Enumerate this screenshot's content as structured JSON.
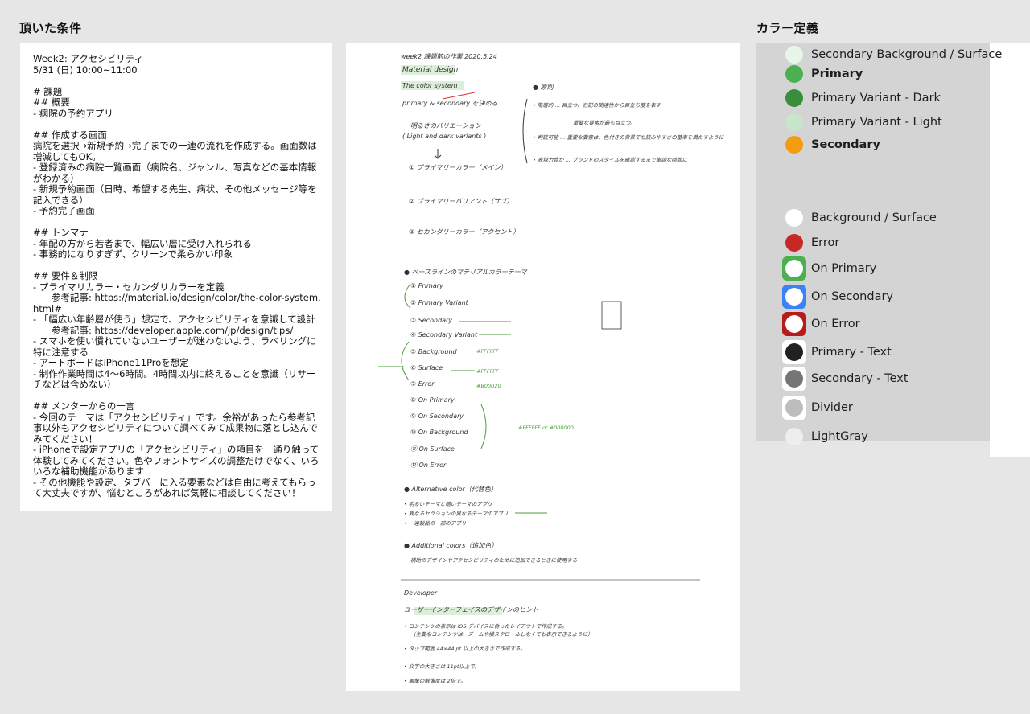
{
  "headings": {
    "left": "頂いた条件",
    "right": "カラー定義"
  },
  "conditions": {
    "lines": [
      "Week2: アクセシビリティ",
      "5/31 (日) 10:00~11:00",
      "",
      "# 課題",
      "## 概要",
      "- 病院の予約アプリ",
      "",
      "## 作成する画面",
      "病院を選択→新規予約→完了までの一連の流れを作成する。画面数は増減してもOK。",
      "- 登録済みの病院一覧画面（病院名、ジャンル、写真などの基本情報がわかる）",
      "- 新規予約画面（日時、希望する先生、病状、その他メッセージ等を記入できる）",
      "- 予約完了画面",
      "",
      "## トンマナ",
      "- 年配の方から若者まで、幅広い層に受け入れられる",
      "- 事務的になりすぎず、クリーンで柔らかい印象",
      "",
      "## 要件＆制限",
      "- プライマリカラー・セカンダリカラーを定義",
      "　　参考記事: https://material.io/design/color/the-color-system.html#",
      "- 「幅広い年齢層が使う」想定で、アクセシビリティを意識して設計",
      "　　参考記事: https://developer.apple.com/jp/design/tips/",
      "- スマホを使い慣れていないユーザーが迷わないよう、ラベリングに特に注意する",
      "- アートボードはiPhone11Proを想定",
      "- 制作作業時間は4〜6時間。4時間以内に終えることを意識（リサーチなどは含めない）",
      "",
      "## メンターからの一言",
      "- 今回のテーマは「アクセシビリティ」です。余裕があったら参考記事以外もアクセシビリティについて調べてみて成果物に落とし込んでみてください！",
      "- iPhoneで設定アプリの「アクセシビリティ」の項目を一通り触って体験してみてください。色やフォントサイズの調整だけでなく、いろいろな補助機能があります",
      "- その他機能や設定、タブバーに入る要素などは自由に考えてもらって大丈夫ですが、悩むところがあれば気軽に相談してください！"
    ]
  },
  "notes": {
    "header": "week2 課題前の作業 2020.5.24",
    "title": "Material design",
    "color_system": "The color system",
    "primary_secondary": "primary & secondary を決める",
    "variations": "明るさのバリエーション",
    "light_dark": "( Light and dark variants )",
    "principles": "● 原則",
    "p1": "• 階層的 … 目立つ、右記の関連性から目立ち度を表す",
    "p2": "重要な要素が最も目立つ。",
    "p3": "• 判読可能 … 重要な要素は、色付きの背景でも読みやすさの基準を満たすように",
    "p4": "• 表現力豊か … ブランドのスタイルを確認するまで単調な時間に",
    "n1": "① プライマリーカラー（メイン）",
    "n2": "② プライマリーバリアント（サブ）",
    "n3": "③ セカンダリーカラー（アクセント）",
    "baseline": "● ベースラインのマテリアルカラーテーマ",
    "list": [
      "① Primary",
      "② Primary Variant",
      "③ Secondary",
      "④ Secondary Variant",
      "⑤ Background",
      "⑥ Surface",
      "⑦ Error",
      "⑧ On Primary",
      "⑨ On Secondary",
      "⑩ On Background",
      "⑪ On Surface",
      "⑫ On Error"
    ],
    "bg_hex": "#FFFFFF",
    "surface_hex": "#FFFFFF",
    "error_hex": "#B00020",
    "on_note": "#FFFFFF or #000000",
    "alt": "● Alternative color（代替色）",
    "alt1": "• 明るいテーマと暗いテーマのアプリ",
    "alt2": "• 異なるセクションの異なるテーマのアプリ",
    "alt3": "• 一連製品の一部のアプリ",
    "additional": "● Additional colors（追加色）",
    "additional_note": "補助のデザインやアクセシビリティのために追加できるときに使用する",
    "developer": "Developer",
    "dev_title": "ユーザーインターフェイスのデザインのヒント",
    "d1": "• コンテンツの表示は iOS デバイスに合ったレイアウトで作成する。",
    "d1b": "（主要なコンテンツは、ズームや横スクロールしなくても表示できるように）",
    "d2": "• タップ範囲 44×44 pt 以上の大きさで作成する。",
    "d3": "• 文字の大きさは 11pt以上で。",
    "d4": "• 画像の解像度は 2倍で。"
  },
  "colors": [
    {
      "label": "Secondary Background / Surface",
      "color": "#e8f5e9",
      "bold": false,
      "frame": null
    },
    {
      "label": "Primary",
      "color": "#4caf50",
      "bold": true,
      "frame": null
    },
    {
      "label": "Primary Variant - Dark",
      "color": "#388e3c",
      "bold": false,
      "frame": null
    },
    {
      "label": "Primary Variant - Light",
      "color": "#c8e6c9",
      "bold": false,
      "frame": null
    },
    {
      "label": "Secondary",
      "color": "#f39c12",
      "bold": true,
      "frame": null
    },
    {
      "label": "Background / Surface",
      "color": "#ffffff",
      "bold": false,
      "frame": null
    },
    {
      "label": "Error",
      "color": "#c62828",
      "bold": false,
      "frame": null
    },
    {
      "label": "On Primary",
      "color": "#ffffff",
      "bold": false,
      "frame": "#4caf50"
    },
    {
      "label": "On Secondary",
      "color": "#ffffff",
      "bold": false,
      "frame": "#3b82f6"
    },
    {
      "label": "On Error",
      "color": "#ffffff",
      "bold": false,
      "frame": "#b71c1c"
    },
    {
      "label": "Primary - Text",
      "color": "#212121",
      "bold": false,
      "frame": "#ffffff"
    },
    {
      "label": "Secondary - Text",
      "color": "#757575",
      "bold": false,
      "frame": "#ffffff"
    },
    {
      "label": "Divider",
      "color": "#bdbdbd",
      "bold": false,
      "frame": "#ffffff"
    },
    {
      "label": "LightGray",
      "color": "#eeeeee",
      "bold": false,
      "frame": null
    }
  ]
}
